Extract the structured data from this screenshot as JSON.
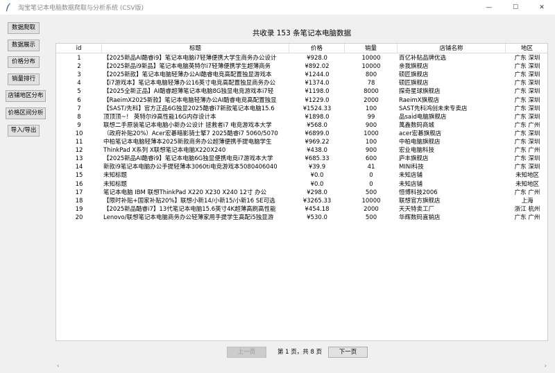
{
  "window": {
    "title": "淘宝笔记本电脑数据爬取与分析系统 (CSV版)",
    "minimize_glyph": "—",
    "maximize_glyph": "☐",
    "close_glyph": "✕"
  },
  "sidebar": {
    "items": [
      {
        "label": "数据爬取"
      },
      {
        "label": "数据展示"
      },
      {
        "label": "价格分布"
      },
      {
        "label": "销量排行"
      },
      {
        "label": "店铺地区分布"
      },
      {
        "label": "价格区间分析"
      },
      {
        "label": "导入/导出"
      }
    ]
  },
  "heading": "共收录  153  条笔记本电脑数据",
  "table": {
    "headers": [
      "id",
      "标题",
      "价格",
      "销量",
      "店铺名称",
      "地区"
    ],
    "rows": [
      [
        "1",
        "【2025新品AI酷睿i9】笔记本电脑i7轻薄便携大学生商务办公设计",
        "¥928.0",
        "10000",
        "百亿补贴品牌优选",
        "广东 深圳"
      ],
      [
        "2",
        "【2025新品i9新品】笔记本电脑英特尔i7轻薄便携学生超薄商务",
        "¥892.02",
        "10000",
        "亲我旗舰店",
        "广东 深圳"
      ],
      [
        "3",
        "【2025新款】笔记本电脑轻薄办公AI酷睿电竞高配置独显游戏本",
        "¥1244.0",
        "800",
        "硕匠旗舰店",
        "广东 深圳"
      ],
      [
        "4",
        "【i7游戏本】笔记本电脑轻薄办公16英寸电竞高配置独显商务办公",
        "¥1374.0",
        "78",
        "硕匠旗舰店",
        "广东 深圳"
      ],
      [
        "5",
        "【2025全新正品】AI酷睿超薄笔记本电脑8G独显电竞游戏本i7轻",
        "¥1198.0",
        "8000",
        "探奇星球旗舰店",
        "广东 深圳"
      ],
      [
        "6",
        "【RaeimX2025新款】笔记本电脑轻薄办公AI酷睿电竞高配置独显",
        "¥1229.0",
        "2000",
        "RaeimX旗舰店",
        "广东 深圳"
      ],
      [
        "7",
        "【SAST/先科】官方正品6G独显2025酷睿i7新款笔记本电脑15.6",
        "¥1524.33",
        "100",
        "SAST先科鸿创未来专卖店",
        "广东 深圳"
      ],
      [
        "8",
        "顶顶顶~！ 英特尔i9高性能16G内存设计本",
        "¥1898.0",
        "99",
        "品said电脑旗舰店",
        "广东 深圳"
      ],
      [
        "9",
        "联想二手原装笔记本电脑小新办公设计 拯救者i7 电竞游戏本大学",
        "¥568.0",
        "900",
        "萬鑫数码商城",
        "广东 广州"
      ],
      [
        "10",
        "（政府补贴20%）Acer宏碁暗影骑士擎7 2025酷睿i7 5060/5070",
        "¥6899.0",
        "1000",
        "acer宏碁旗舰店",
        "广东 深圳"
      ],
      [
        "11",
        "中柏笔记本电脑轻薄本2025新款商务办公超薄便携手提电脑学生",
        "¥969.22",
        "100",
        "中柏电脑旗舰店",
        "广东 深圳"
      ],
      [
        "12",
        "ThinkPad X系列 X联想笔记本电脑X220X240",
        "¥438.0",
        "900",
        "宏业电脑科技",
        "广东 广州"
      ],
      [
        "13",
        "【2025新品AI酷睿i9】笔记本电脑6G独显便携电竞i7游戏本大学",
        "¥685.33",
        "600",
        "庐丰旗舰店",
        "广东 深圳"
      ],
      [
        "14",
        "新款i9笔记本电脑办公手提轻薄本3060ti电竞游戏本5080406040",
        "¥39.9",
        "41",
        "MINI科技",
        "广东 深圳"
      ],
      [
        "15",
        "未知标题",
        "¥0.0",
        "0",
        "未知店铺",
        "未知地区"
      ],
      [
        "16",
        "未知标题",
        "¥0.0",
        "0",
        "未知店铺",
        "未知地区"
      ],
      [
        "17",
        "笔记本电脑 IBM 联想ThinkPad  X220  X230  X240  12寸 办公",
        "¥298.0",
        "500",
        "恒博科技2006",
        "广东 广州"
      ],
      [
        "18",
        "【限时补贴+国家补贴20%】联想小新14/小新15/小新16 SE可选",
        "¥3265.33",
        "10000",
        "联想官方旗舰店",
        "上海"
      ],
      [
        "19",
        "【2025新品酷睿i7】13代笔记本电脑15.6英寸4K超薄高刷高性能",
        "¥454.18",
        "2000",
        "天天特卖工厂",
        "浙江 杭州"
      ],
      [
        "20",
        "Lenovo/联想笔记本电脑商务办公轻薄家用手提学生高配i5独显游",
        "¥530.0",
        "500",
        "华辉数码直销店",
        "广东 广州"
      ]
    ]
  },
  "pagination": {
    "prev_label": "上一页",
    "info": "第 1 页，共 8 页",
    "next_label": "下一页"
  },
  "scrollbar": {
    "left_glyph": "‹",
    "right_glyph": "›"
  },
  "colors": {
    "app_icon": "#2b5797"
  }
}
